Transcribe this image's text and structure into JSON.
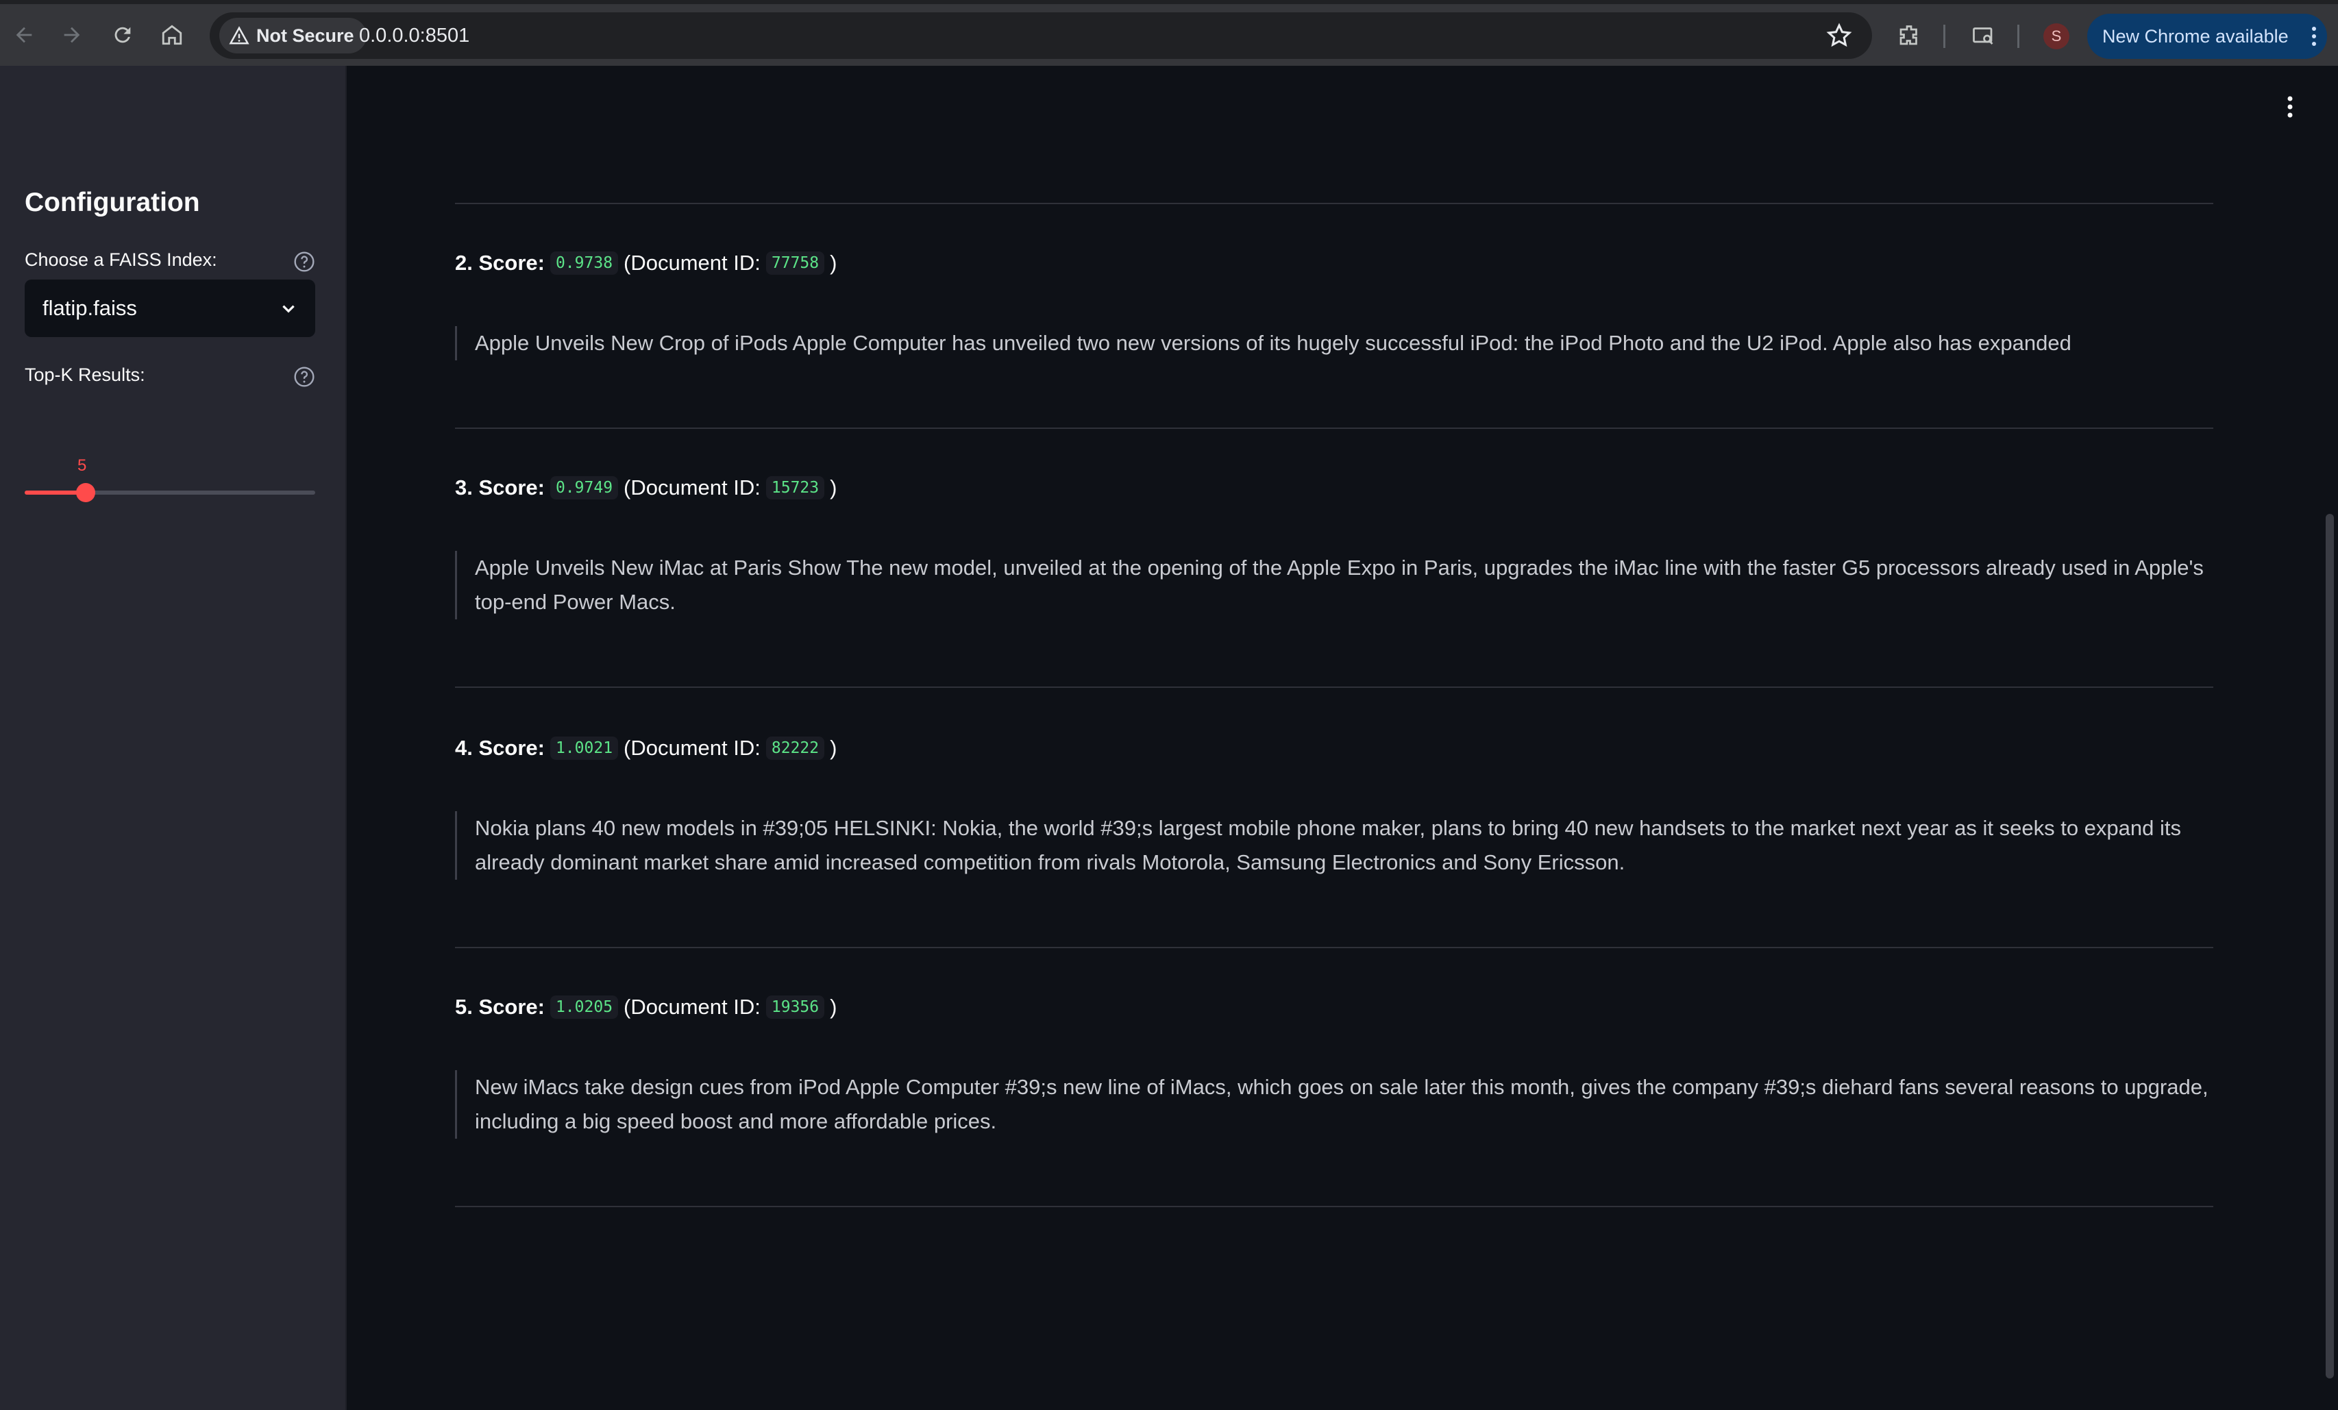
{
  "browser": {
    "security_label": "Not Secure",
    "url": "0.0.0.0:8501",
    "profile_initial": "S",
    "update_label": "New Chrome available"
  },
  "sidebar": {
    "title": "Configuration",
    "index_label": "Choose a FAISS Index:",
    "index_value": "flatip.faiss",
    "topk_label": "Top-K Results:",
    "topk_value": "5",
    "topk_fraction": 0.21
  },
  "results": [
    {
      "head_prefix": "2. Score:",
      "score": "0.9738",
      "docid_prefix": "(Document ID:",
      "doc_id": "77758",
      "close": ")",
      "text": "Apple Unveils New Crop of iPods Apple Computer has unveiled two new versions of its hugely successful iPod: the iPod Photo and the U2 iPod. Apple also has expanded"
    },
    {
      "head_prefix": "3. Score:",
      "score": "0.9749",
      "docid_prefix": "(Document ID:",
      "doc_id": "15723",
      "close": ")",
      "text": "Apple Unveils New iMac at Paris Show The new model, unveiled at the opening of the Apple Expo in Paris, upgrades the iMac line with the faster G5 processors already used in Apple's top-end Power Macs."
    },
    {
      "head_prefix": "4. Score:",
      "score": "1.0021",
      "docid_prefix": "(Document ID:",
      "doc_id": "82222",
      "close": ")",
      "text": "Nokia plans 40 new models in #39;05 HELSINKI: Nokia, the world #39;s largest mobile phone maker, plans to bring 40 new handsets to the market next year as it seeks to expand its already dominant market share amid increased competition from rivals Motorola, Samsung Electronics and Sony Ericsson."
    },
    {
      "head_prefix": "5. Score:",
      "score": "1.0205",
      "docid_prefix": "(Document ID:",
      "doc_id": "19356",
      "close": ")",
      "text": "New iMacs take design cues from iPod Apple Computer #39;s new line of iMacs, which goes on sale later this month, gives the company #39;s diehard fans several reasons to upgrade, including a big speed boost and more affordable prices."
    }
  ]
}
